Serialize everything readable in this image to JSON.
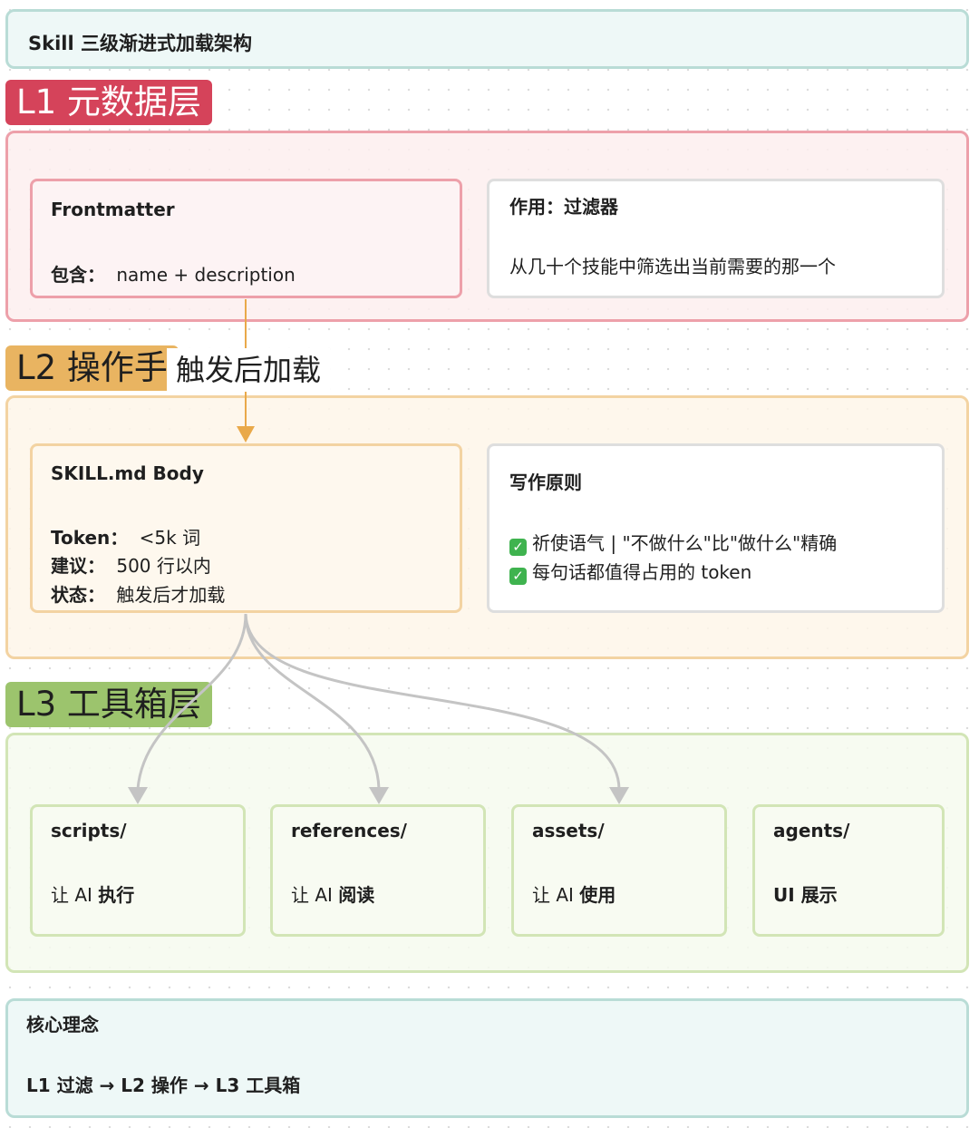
{
  "title": "Skill 三级渐进式加载架构",
  "l1": {
    "tag": "L1 元数据层",
    "frontmatter": {
      "title": "Frontmatter",
      "contains_label": "包含：",
      "contains_value": "name + description"
    },
    "role": {
      "title": "作用：过滤器",
      "desc": "从几十个技能中筛选出当前需要的那一个"
    }
  },
  "l2": {
    "tag": "L2 操作手",
    "trigger_label": "触发后加载",
    "body": {
      "title": "SKILL.md Body",
      "token_label": "Token：",
      "token_value": "<5k 词",
      "advice_label": "建议：",
      "advice_value": "500 行以内",
      "status_label": "状态：",
      "status_value": "触发后才加载"
    },
    "principles": {
      "title": "写作原则",
      "items": [
        "祈使语气 | \"不做什么\"比\"做什么\"精确",
        "每句话都值得占用的 token"
      ]
    }
  },
  "l3": {
    "tag": "L3 工具箱层",
    "cards": [
      {
        "title": "scripts/",
        "prefix": "让 AI ",
        "action": "执行"
      },
      {
        "title": "references/",
        "prefix": "让 AI ",
        "action": "阅读"
      },
      {
        "title": "assets/",
        "prefix": "让 AI ",
        "action": "使用"
      },
      {
        "title": "agents/",
        "prefix": "",
        "action": "UI 展示"
      }
    ]
  },
  "core": {
    "title": "核心理念",
    "flow": "L1 过滤 → L2 操作 → L3 工具箱"
  },
  "colors": {
    "l1": "#d5435a",
    "l2": "#e9b461",
    "l3": "#9cc46d",
    "core": "#b9dcd6"
  }
}
